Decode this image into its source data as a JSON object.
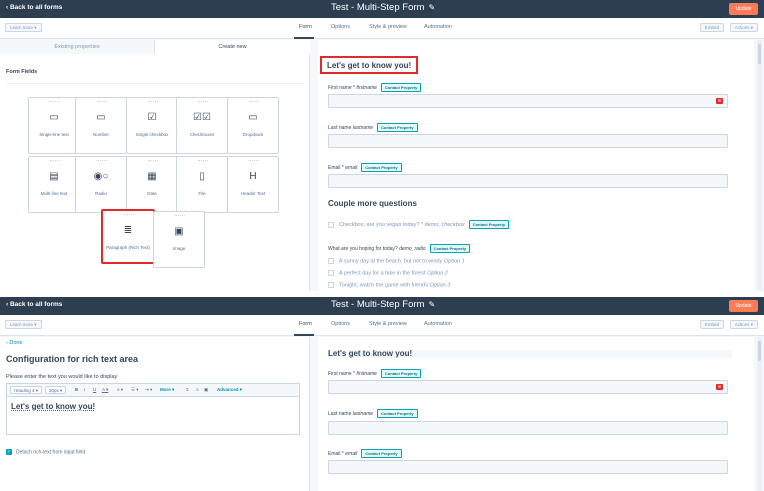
{
  "header": {
    "back_label": "Back to all forms",
    "form_title": "Test - Multi-Step Form",
    "update_label": "Update"
  },
  "secondary": {
    "learn_more": "Learn more",
    "tabs": [
      "Form",
      "Options",
      "Style & preview",
      "Automation"
    ],
    "embed": "Embed",
    "actions": "Actions"
  },
  "top_panel": {
    "subtabs": [
      "Existing properties",
      "Create new"
    ],
    "form_fields_title": "Form Fields",
    "field_types": [
      {
        "label": "Single-line text",
        "icon": "single-line-text-icon",
        "glyph": "▭"
      },
      {
        "label": "Number",
        "icon": "number-icon",
        "glyph": "▭"
      },
      {
        "label": "Single checkbox",
        "icon": "single-checkbox-icon",
        "glyph": "☑"
      },
      {
        "label": "Checkboxes",
        "icon": "checkboxes-icon",
        "glyph": "☑☑"
      },
      {
        "label": "Dropdown",
        "icon": "dropdown-icon",
        "glyph": "▭"
      },
      {
        "label": "Multi-line text",
        "icon": "multi-line-text-icon",
        "glyph": "▤"
      },
      {
        "label": "Radio",
        "icon": "radio-icon",
        "glyph": "◉○"
      },
      {
        "label": "Date",
        "icon": "date-icon",
        "glyph": "▦"
      },
      {
        "label": "File",
        "icon": "file-icon",
        "glyph": "▯"
      },
      {
        "label": "Header Text",
        "icon": "header-text-icon",
        "glyph": "H"
      },
      {
        "label": "Paragraph (Rich Text)",
        "icon": "paragraph-icon",
        "glyph": "≣"
      },
      {
        "label": "Image",
        "icon": "image-icon",
        "glyph": "▣"
      }
    ],
    "preview": {
      "heading": "Let's get to know you!",
      "first_name": {
        "label": "First name",
        "required": " *",
        "prop": "firstname"
      },
      "last_name": {
        "label": "Last name",
        "prop": "lastname"
      },
      "email": {
        "label": "Email",
        "required": " *",
        "prop": "email"
      },
      "badge": "Contact Property",
      "section2": "Couple more questions",
      "vegan": {
        "text": "Checkbox, are you vegan today?",
        "required": " *",
        "prop": "demo_checkbox"
      },
      "hoping": {
        "label": "What are you hoping for today?",
        "prop": "demo_radio"
      },
      "options": [
        {
          "text": "A sunny day at the beach, but not to windy",
          "opt": "Option 1"
        },
        {
          "text": "A perfect day for a hike in the forest",
          "opt": "Option 2"
        },
        {
          "text": "Tonight, watch the game with friends",
          "opt": "Option 3"
        }
      ]
    }
  },
  "bottom_panel": {
    "done": "Done",
    "config_title": "Configuration for rich text area",
    "prompt": "Please enter the text you would like to display",
    "toolbar": {
      "heading": "Heading 4",
      "size": "20px",
      "bold": "B",
      "italic": "I",
      "underline": "U",
      "color": "A",
      "align": "≡",
      "list": "☰",
      "indent": "⇥",
      "more": "More",
      "sigma": "Σ",
      "emoji": "☺",
      "image": "▣",
      "advanced": "Advanced"
    },
    "content": "Let's get to know you!",
    "detach": "Detach rich-text from input field"
  }
}
